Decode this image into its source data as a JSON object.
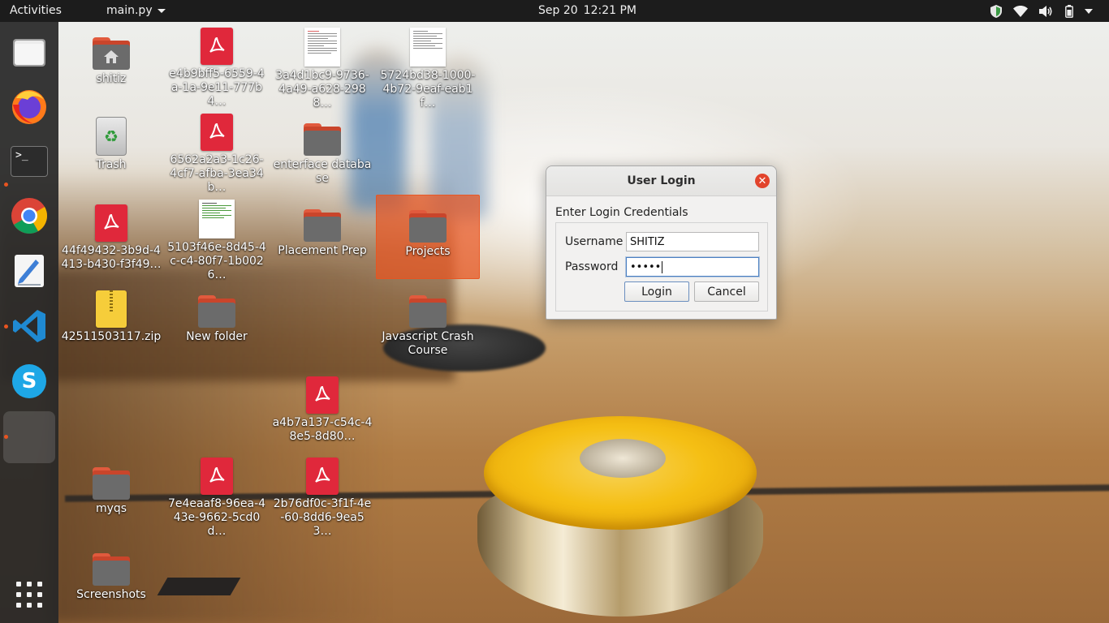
{
  "topbar": {
    "activities": "Activities",
    "app_menu": "main.py",
    "date": "Sep 20",
    "time": "12:21 PM"
  },
  "dock": {
    "items": [
      {
        "name": "files-icon"
      },
      {
        "name": "firefox-icon"
      },
      {
        "name": "terminal-icon",
        "glyph": ">_"
      },
      {
        "name": "chrome-icon"
      },
      {
        "name": "text-editor-icon"
      },
      {
        "name": "vscode-icon"
      },
      {
        "name": "skype-icon",
        "glyph": "S"
      },
      {
        "name": "python-app-window"
      }
    ],
    "show_apps": "show-applications-icon"
  },
  "desktop": {
    "icons": [
      {
        "label": "shitiz",
        "type": "home-folder"
      },
      {
        "label": "e4b9bff5-6559-4a-1a-9e11-777b4…",
        "type": "pdf"
      },
      {
        "label": "3a4d1bc9-9736-4a49-a628-2988…",
        "type": "document"
      },
      {
        "label": "5724bd38-1000-4b72-9eaf-eab1f…",
        "type": "document"
      },
      {
        "label": "Trash",
        "type": "trash"
      },
      {
        "label": "6562a2a3-1c26-4cf7-afba-3ea34b…",
        "type": "pdf"
      },
      {
        "label": "enterface database",
        "type": "folder"
      },
      {
        "label": "44f49432-3b9d-4413-b430-f3f49…",
        "type": "pdf"
      },
      {
        "label": "5103f46e-8d45-4c-c4-80f7-1b0026…",
        "type": "document"
      },
      {
        "label": "Placement Prep",
        "type": "folder"
      },
      {
        "label": "Projects",
        "type": "folder",
        "selected": true
      },
      {
        "label": "42511503117.zip",
        "type": "zip"
      },
      {
        "label": "New folder",
        "type": "folder"
      },
      {
        "label": "Javascript Crash Course",
        "type": "folder"
      },
      {
        "label": "a4b7a137-c54c-48e5-8d80…",
        "type": "pdf"
      },
      {
        "label": "myqs",
        "type": "folder"
      },
      {
        "label": "7e4eaaf8-96ea-443e-9662-5cd0d…",
        "type": "pdf"
      },
      {
        "label": "2b76df0c-3f1f-4e-60-8dd6-9ea53…",
        "type": "pdf"
      },
      {
        "label": "Screenshots",
        "type": "folder"
      }
    ]
  },
  "dialog": {
    "title": "User Login",
    "heading": "Enter Login Credentials",
    "username_label": "Username",
    "username_value": "SHITIZ",
    "password_label": "Password",
    "password_value": "•••••",
    "login_button": "Login",
    "cancel_button": "Cancel"
  },
  "colors": {
    "accent": "#e95420",
    "topbar": "#1c1c1c",
    "dock": "#282828",
    "close_button": "#e2442c",
    "pdf_red": "#e0283b"
  }
}
